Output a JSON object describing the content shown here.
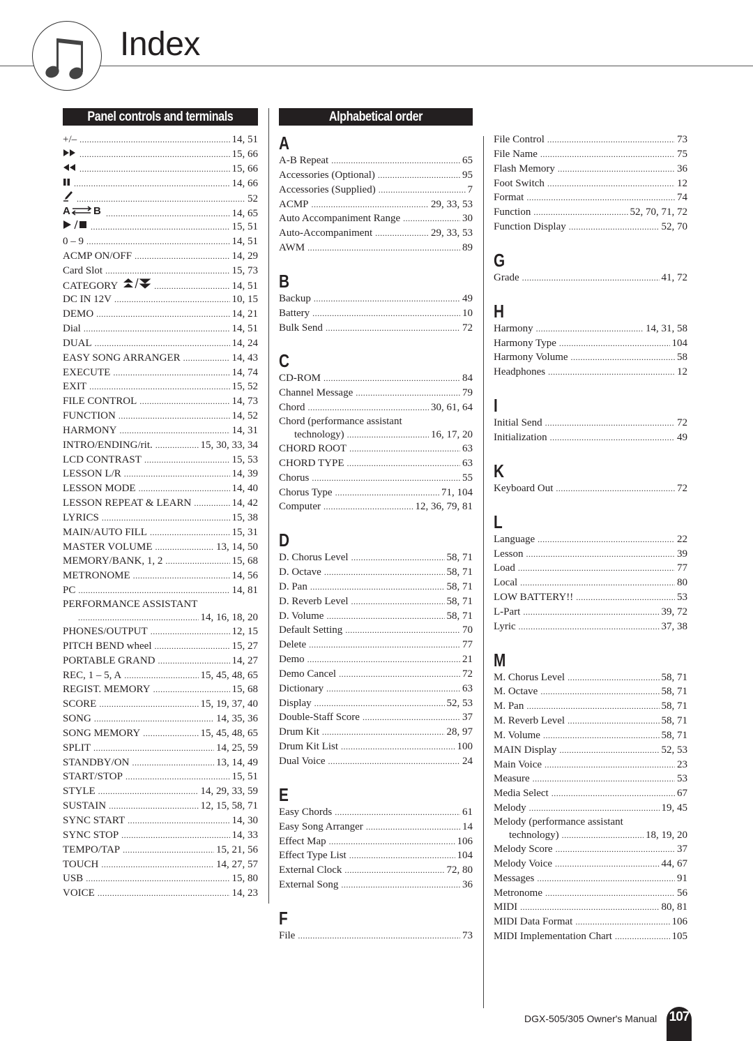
{
  "page": {
    "title": "Index",
    "icon": "music-note-icon",
    "footer": "DGX-505/305  Owner's Manual",
    "page_number": "107"
  },
  "panel_controls": {
    "heading": "Panel controls and terminals",
    "entries": [
      {
        "name": "+/–",
        "pages": "14, 51"
      },
      {
        "name": "",
        "symbol": "fast-forward-icon",
        "pages": "15, 66"
      },
      {
        "name": "",
        "symbol": "rewind-icon",
        "pages": "15, 66"
      },
      {
        "name": "",
        "symbol": "pause-icon",
        "pages": "14, 66"
      },
      {
        "name": "",
        "symbol": "metronome-pen-icon",
        "pages": "52"
      },
      {
        "name": "",
        "symbol": "a-b-repeat-icon",
        "pages": "14, 65"
      },
      {
        "name": "",
        "symbol": "play-stop-icon",
        "pages": "15, 51"
      },
      {
        "name": "0 – 9",
        "pages": "14, 51"
      },
      {
        "name": "ACMP ON/OFF",
        "pages": "14, 29"
      },
      {
        "name": "Card Slot",
        "pages": "15, 73"
      },
      {
        "name": "CATEGORY",
        "symbol": "category-up-down-icon",
        "pages": "14, 51"
      },
      {
        "name": "DC IN 12V",
        "pages": "10, 15"
      },
      {
        "name": "DEMO",
        "pages": "14, 21"
      },
      {
        "name": "Dial",
        "pages": "14, 51"
      },
      {
        "name": "DUAL",
        "pages": "14, 24"
      },
      {
        "name": "EASY SONG ARRANGER",
        "pages": "14, 43"
      },
      {
        "name": "EXECUTE",
        "pages": "14, 74"
      },
      {
        "name": "EXIT",
        "pages": "15, 52"
      },
      {
        "name": "FILE CONTROL",
        "pages": "14, 73"
      },
      {
        "name": "FUNCTION",
        "pages": "14, 52"
      },
      {
        "name": "HARMONY",
        "pages": "14, 31"
      },
      {
        "name": "INTRO/ENDING/rit.",
        "pages": "15, 30, 33, 34"
      },
      {
        "name": "LCD CONTRAST",
        "pages": "15, 53"
      },
      {
        "name": "LESSON L/R",
        "pages": "14, 39"
      },
      {
        "name": "LESSON MODE",
        "pages": "14, 40"
      },
      {
        "name": "LESSON REPEAT & LEARN",
        "pages": "14, 42"
      },
      {
        "name": "LYRICS",
        "pages": "15, 38"
      },
      {
        "name": "MAIN/AUTO FILL",
        "pages": "15, 31"
      },
      {
        "name": "MASTER VOLUME",
        "pages": "13, 14, 50"
      },
      {
        "name": "MEMORY/BANK, 1, 2",
        "pages": "15, 68"
      },
      {
        "name": "METRONOME",
        "pages": "14, 56"
      },
      {
        "name": "PC",
        "pages": "14, 81"
      },
      {
        "name": "PERFORMANCE ASSISTANT",
        "pages": "14, 16, 18, 20",
        "wrapped": true
      },
      {
        "name": "PHONES/OUTPUT",
        "pages": "12, 15"
      },
      {
        "name": "PITCH BEND wheel",
        "pages": "15, 27"
      },
      {
        "name": "PORTABLE GRAND",
        "pages": "14, 27"
      },
      {
        "name": "REC, 1 – 5, A",
        "pages": "15, 45, 48, 65"
      },
      {
        "name": "REGIST. MEMORY",
        "pages": "15, 68"
      },
      {
        "name": "SCORE",
        "pages": "15, 19, 37, 40"
      },
      {
        "name": "SONG",
        "pages": "14, 35, 36"
      },
      {
        "name": "SONG MEMORY",
        "pages": "15, 45, 48, 65"
      },
      {
        "name": "SPLIT",
        "pages": "14, 25, 59"
      },
      {
        "name": "STANDBY/ON",
        "pages": "13, 14, 49"
      },
      {
        "name": "START/STOP",
        "pages": "15, 51"
      },
      {
        "name": "STYLE",
        "pages": "14, 29, 33, 59"
      },
      {
        "name": "SUSTAIN",
        "pages": "12, 15, 58, 71"
      },
      {
        "name": "SYNC START",
        "pages": "14, 30"
      },
      {
        "name": "SYNC STOP",
        "pages": "14, 33"
      },
      {
        "name": "TEMPO/TAP",
        "pages": "15, 21, 56"
      },
      {
        "name": "TOUCH",
        "pages": "14, 27, 57"
      },
      {
        "name": "USB",
        "pages": "15, 80"
      },
      {
        "name": "VOICE",
        "pages": "14, 23"
      }
    ]
  },
  "alphabetical": {
    "heading": "Alphabetical order",
    "groups": [
      {
        "letter": "A",
        "entries": [
          {
            "name": "A-B Repeat",
            "pages": "65"
          },
          {
            "name": "Accessories (Optional)",
            "pages": "95"
          },
          {
            "name": "Accessories (Supplied)",
            "pages": "7"
          },
          {
            "name": "ACMP",
            "pages": "29, 33, 53"
          },
          {
            "name": "Auto Accompaniment Range",
            "pages": "30"
          },
          {
            "name": "Auto-Accompaniment",
            "pages": "29, 33, 53"
          },
          {
            "name": "AWM",
            "pages": "89"
          }
        ]
      },
      {
        "letter": "B",
        "entries": [
          {
            "name": "Backup",
            "pages": "49"
          },
          {
            "name": "Battery",
            "pages": "10"
          },
          {
            "name": "Bulk Send",
            "pages": "72"
          }
        ]
      },
      {
        "letter": "C",
        "entries": [
          {
            "name": "CD-ROM",
            "pages": "84"
          },
          {
            "name": "Channel Message",
            "pages": "79"
          },
          {
            "name": "Chord",
            "pages": "30, 61, 64"
          },
          {
            "name": "Chord (performance assistant",
            "continuation": "technology)",
            "pages": "16, 17, 20",
            "wrapped": true
          },
          {
            "name": "CHORD ROOT",
            "pages": "63"
          },
          {
            "name": "CHORD TYPE",
            "pages": "63"
          },
          {
            "name": "Chorus",
            "pages": "55"
          },
          {
            "name": "Chorus Type",
            "pages": "71, 104"
          },
          {
            "name": "Computer",
            "pages": "12, 36, 79, 81"
          }
        ]
      },
      {
        "letter": "D",
        "entries": [
          {
            "name": "D. Chorus Level",
            "pages": "58, 71"
          },
          {
            "name": "D. Octave",
            "pages": "58, 71"
          },
          {
            "name": "D. Pan",
            "pages": "58, 71"
          },
          {
            "name": "D. Reverb Level",
            "pages": "58, 71"
          },
          {
            "name": "D. Volume",
            "pages": "58, 71"
          },
          {
            "name": "Default Setting",
            "pages": "70"
          },
          {
            "name": "Delete",
            "pages": "77"
          },
          {
            "name": "Demo",
            "pages": "21"
          },
          {
            "name": "Demo Cancel",
            "pages": "72"
          },
          {
            "name": "Dictionary",
            "pages": "63"
          },
          {
            "name": "Display",
            "pages": "52, 53"
          },
          {
            "name": "Double-Staff Score",
            "pages": "37"
          },
          {
            "name": "Drum Kit",
            "pages": "28, 97"
          },
          {
            "name": "Drum Kit List",
            "pages": "100"
          },
          {
            "name": "Dual Voice",
            "pages": "24"
          }
        ]
      },
      {
        "letter": "E",
        "entries": [
          {
            "name": "Easy Chords",
            "pages": "61"
          },
          {
            "name": "Easy Song Arranger",
            "pages": "14"
          },
          {
            "name": "Effect Map",
            "pages": "106"
          },
          {
            "name": "Effect Type List",
            "pages": "104"
          },
          {
            "name": "External Clock",
            "pages": "72, 80"
          },
          {
            "name": "External Song",
            "pages": "36"
          }
        ]
      },
      {
        "letter": "F",
        "entries": [
          {
            "name": "File",
            "pages": "73"
          },
          {
            "name": "File Control",
            "pages": "73"
          },
          {
            "name": "File Name",
            "pages": "75"
          },
          {
            "name": "Flash Memory",
            "pages": "36"
          },
          {
            "name": "Foot Switch",
            "pages": "12"
          },
          {
            "name": "Format",
            "pages": "74"
          },
          {
            "name": "Function",
            "pages": "52, 70, 71, 72"
          },
          {
            "name": "Function Display",
            "pages": "52, 70"
          }
        ]
      },
      {
        "letter": "G",
        "entries": [
          {
            "name": "Grade",
            "pages": "41, 72"
          }
        ]
      },
      {
        "letter": "H",
        "entries": [
          {
            "name": "Harmony",
            "pages": "14, 31, 58"
          },
          {
            "name": "Harmony Type",
            "pages": "104"
          },
          {
            "name": "Harmony Volume",
            "pages": "58"
          },
          {
            "name": "Headphones",
            "pages": "12"
          }
        ]
      },
      {
        "letter": "I",
        "entries": [
          {
            "name": "Initial Send",
            "pages": "72"
          },
          {
            "name": "Initialization",
            "pages": "49"
          }
        ]
      },
      {
        "letter": "K",
        "entries": [
          {
            "name": "Keyboard Out",
            "pages": "72"
          }
        ]
      },
      {
        "letter": "L",
        "entries": [
          {
            "name": "Language",
            "pages": "22"
          },
          {
            "name": "Lesson",
            "pages": "39"
          },
          {
            "name": "Load",
            "pages": "77"
          },
          {
            "name": "Local",
            "pages": "80"
          },
          {
            "name": "LOW BATTERY!!",
            "pages": "53"
          },
          {
            "name": "L-Part",
            "pages": "39, 72"
          },
          {
            "name": "Lyric",
            "pages": "37, 38"
          }
        ]
      },
      {
        "letter": "M",
        "entries": [
          {
            "name": "M. Chorus Level",
            "pages": "58, 71"
          },
          {
            "name": "M. Octave",
            "pages": "58, 71"
          },
          {
            "name": "M. Pan",
            "pages": "58, 71"
          },
          {
            "name": "M. Reverb Level",
            "pages": "58, 71"
          },
          {
            "name": "M. Volume",
            "pages": "58, 71"
          },
          {
            "name": "MAIN Display",
            "pages": "52, 53"
          },
          {
            "name": "Main Voice",
            "pages": "23"
          },
          {
            "name": "Measure",
            "pages": "53"
          },
          {
            "name": "Media Select",
            "pages": "67"
          },
          {
            "name": "Melody",
            "pages": "19, 45"
          },
          {
            "name": "Melody (performance assistant",
            "continuation": "technology)",
            "pages": "18, 19, 20",
            "wrapped": true
          },
          {
            "name": "Melody Score",
            "pages": "37"
          },
          {
            "name": "Melody Voice",
            "pages": "44, 67"
          },
          {
            "name": "Messages",
            "pages": "91"
          },
          {
            "name": "Metronome",
            "pages": "56"
          },
          {
            "name": "MIDI",
            "pages": "80, 81"
          },
          {
            "name": "MIDI Data Format",
            "pages": "106"
          },
          {
            "name": "MIDI Implementation Chart",
            "pages": "105"
          }
        ]
      }
    ]
  }
}
